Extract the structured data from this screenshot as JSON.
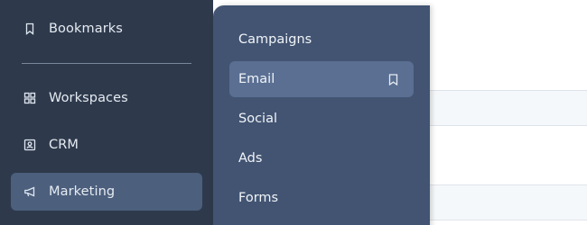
{
  "sidebar": {
    "items": [
      {
        "label": "Bookmarks",
        "icon": "bookmark-icon"
      },
      {
        "label": "Workspaces",
        "icon": "grid-icon"
      },
      {
        "label": "CRM",
        "icon": "contact-card-icon"
      },
      {
        "label": "Marketing",
        "icon": "megaphone-icon",
        "active": true
      }
    ]
  },
  "submenu": {
    "items": [
      {
        "label": "Campaigns"
      },
      {
        "label": "Email",
        "hover": true,
        "icon": "bookmark-icon"
      },
      {
        "label": "Social"
      },
      {
        "label": "Ads"
      },
      {
        "label": "Forms"
      }
    ]
  },
  "colors": {
    "sidebar_bg": "#2e3a4c",
    "sidebar_active": "#4c5f7d",
    "flyout_bg": "#425472",
    "flyout_hover": "#5a6f92",
    "text": "#e6ebf2"
  }
}
